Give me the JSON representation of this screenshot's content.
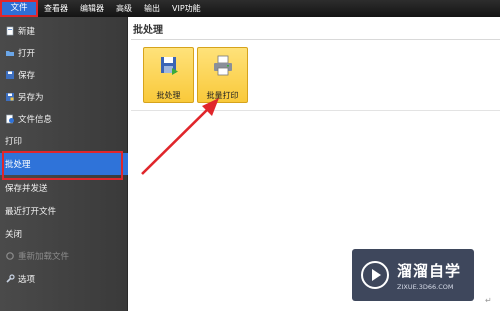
{
  "menubar": {
    "tabs": [
      {
        "label": "文件",
        "active": true
      },
      {
        "label": "查看器"
      },
      {
        "label": "编辑器"
      },
      {
        "label": "高级"
      },
      {
        "label": "输出"
      },
      {
        "label": "VIP功能"
      }
    ]
  },
  "sidebar": {
    "items": [
      {
        "label": "新建",
        "icon": "new-file-icon"
      },
      {
        "label": "打开",
        "icon": "folder-open-icon"
      },
      {
        "label": "保存",
        "icon": "save-icon"
      },
      {
        "label": "另存为",
        "icon": "save-as-icon"
      },
      {
        "label": "文件信息",
        "icon": "info-icon"
      },
      {
        "label": "打印"
      },
      {
        "label": "批处理",
        "selected": true
      },
      {
        "label": "保存并发送"
      },
      {
        "label": "最近打开文件"
      },
      {
        "label": "关闭"
      },
      {
        "label": "重新加载文件",
        "icon": "reload-icon",
        "disabled": true
      },
      {
        "label": "选项",
        "icon": "wrench-icon"
      }
    ]
  },
  "content": {
    "title": "批处理",
    "tiles": [
      {
        "label": "批处理",
        "icon": "batch-save-icon"
      },
      {
        "label": "批量打印",
        "icon": "batch-print-icon"
      }
    ]
  },
  "watermark": {
    "main": "溜溜自学",
    "sub": "ZIXUE.3D66.COM"
  },
  "colors": {
    "menubar": "#1e1e1e",
    "active_tab": "#2f6fd6",
    "highlight_red": "#e0262b",
    "sidebar": "#424242",
    "selected_item": "#2f73d9",
    "tile": "#f9c93a"
  }
}
